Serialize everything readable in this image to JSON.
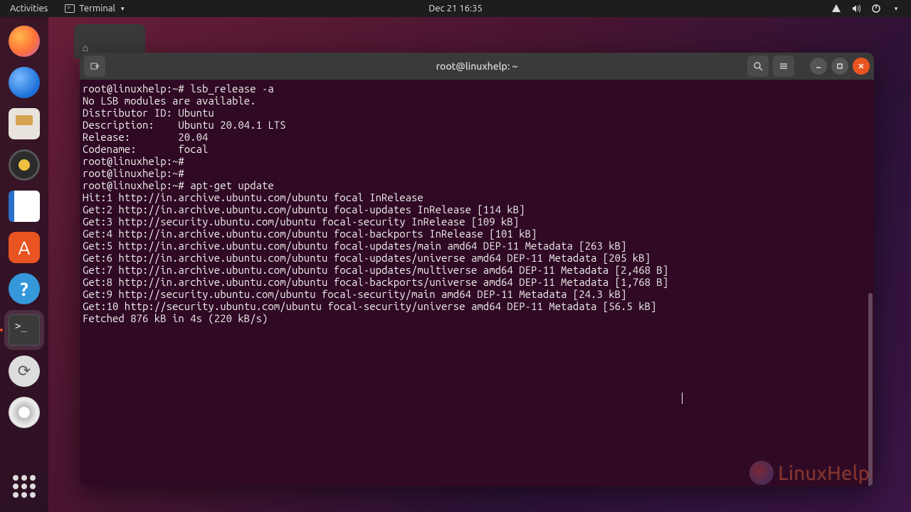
{
  "topbar": {
    "activities": "Activities",
    "app_label": "Terminal",
    "datetime": "Dec 21  16:35"
  },
  "dock": {
    "items": [
      {
        "name": "firefox"
      },
      {
        "name": "thunderbird"
      },
      {
        "name": "files"
      },
      {
        "name": "rhythmbox"
      },
      {
        "name": "libreoffice-writer"
      },
      {
        "name": "ubuntu-software"
      },
      {
        "name": "help"
      },
      {
        "name": "terminal"
      },
      {
        "name": "software-updater"
      },
      {
        "name": "disc"
      }
    ]
  },
  "terminal": {
    "title": "root@linuxhelp: ~",
    "prompt": "root@linuxhelp:~#",
    "lines": [
      "root@linuxhelp:~# lsb_release -a",
      "No LSB modules are available.",
      "Distributor ID: Ubuntu",
      "Description:    Ubuntu 20.04.1 LTS",
      "Release:        20.04",
      "Codename:       focal",
      "root@linuxhelp:~#",
      "root@linuxhelp:~#",
      "root@linuxhelp:~# apt-get update",
      "Hit:1 http://in.archive.ubuntu.com/ubuntu focal InRelease",
      "Get:2 http://in.archive.ubuntu.com/ubuntu focal-updates InRelease [114 kB]",
      "Get:3 http://security.ubuntu.com/ubuntu focal-security InRelease [109 kB]",
      "Get:4 http://in.archive.ubuntu.com/ubuntu focal-backports InRelease [101 kB]",
      "Get:5 http://in.archive.ubuntu.com/ubuntu focal-updates/main amd64 DEP-11 Metadata [263 kB]",
      "Get:6 http://in.archive.ubuntu.com/ubuntu focal-updates/universe amd64 DEP-11 Metadata [205 kB]",
      "Get:7 http://in.archive.ubuntu.com/ubuntu focal-updates/multiverse amd64 DEP-11 Metadata [2,468 B]",
      "Get:8 http://in.archive.ubuntu.com/ubuntu focal-backports/universe amd64 DEP-11 Metadata [1,768 B]",
      "Get:9 http://security.ubuntu.com/ubuntu focal-security/main amd64 DEP-11 Metadata [24.3 kB]",
      "Get:10 http://security.ubuntu.com/ubuntu focal-security/universe amd64 DEP-11 Metadata [56.5 kB]",
      "Fetched 876 kB in 4s (220 kB/s)"
    ]
  },
  "watermark": {
    "text": "LinuxHelp"
  }
}
